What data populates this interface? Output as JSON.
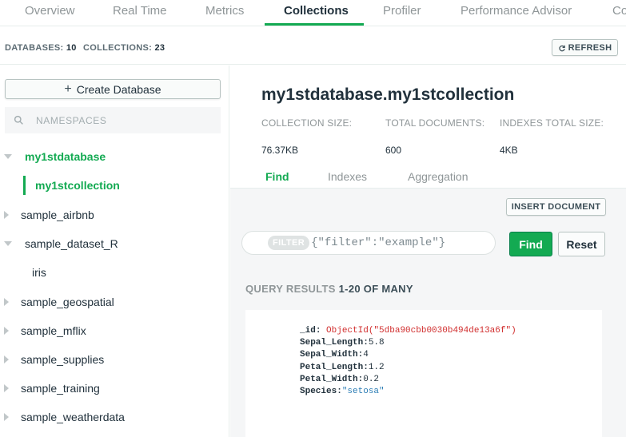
{
  "top_tabs": [
    "Overview",
    "Real Time",
    "Metrics",
    "Collections",
    "Profiler",
    "Performance Advisor",
    "Co"
  ],
  "active_tab": "Collections",
  "stats": {
    "databases_label": "DATABASES:",
    "databases_count": "10",
    "collections_label": "COLLECTIONS:",
    "collections_count": "23",
    "refresh_label": "REFRESH"
  },
  "sidebar": {
    "create_db_label": "Create Database",
    "search_placeholder": "NAMESPACES",
    "items": [
      {
        "label": "my1stdatabase"
      },
      {
        "label": "my1stcollection"
      },
      {
        "label": "sample_airbnb"
      },
      {
        "label": "sample_dataset_R"
      },
      {
        "label": "iris"
      },
      {
        "label": "sample_geospatial"
      },
      {
        "label": "sample_mflix"
      },
      {
        "label": "sample_supplies"
      },
      {
        "label": "sample_training"
      },
      {
        "label": "sample_weatherdata"
      }
    ]
  },
  "collection": {
    "title": "my1stdatabase.my1stcollection",
    "size_label": "COLLECTION SIZE:",
    "size_value": "76.37KB",
    "docs_label": "TOTAL DOCUMENTS:",
    "docs_value": "600",
    "indexes_label": "INDEXES TOTAL SIZE:",
    "indexes_value": "4KB"
  },
  "sub_tabs": [
    "Find",
    "Indexes",
    "Aggregation"
  ],
  "insert_label": "INSERT DOCUMENT",
  "filter": {
    "pill": "FILTER",
    "placeholder": "{\"filter\":\"example\"}",
    "find_label": "Find",
    "reset_label": "Reset"
  },
  "results": {
    "label": "QUERY RESULTS",
    "range": "1-20 OF MANY"
  },
  "document": [
    {
      "key": "_id",
      "value": "ObjectId(\"5dba90cbb0030b494de13a6f\")",
      "kind": "oid"
    },
    {
      "key": "Sepal_Length",
      "value": "5.8",
      "kind": "num"
    },
    {
      "key": "Sepal_Width",
      "value": "4",
      "kind": "num"
    },
    {
      "key": "Petal_Length",
      "value": "1.2",
      "kind": "num"
    },
    {
      "key": "Petal_Width",
      "value": "0.2",
      "kind": "num"
    },
    {
      "key": "Species",
      "value": "\"setosa\"",
      "kind": "str"
    }
  ],
  "colors": {
    "accent": "#13aa52",
    "string": "#2d7eb5",
    "objectid": "#d12e2e"
  }
}
